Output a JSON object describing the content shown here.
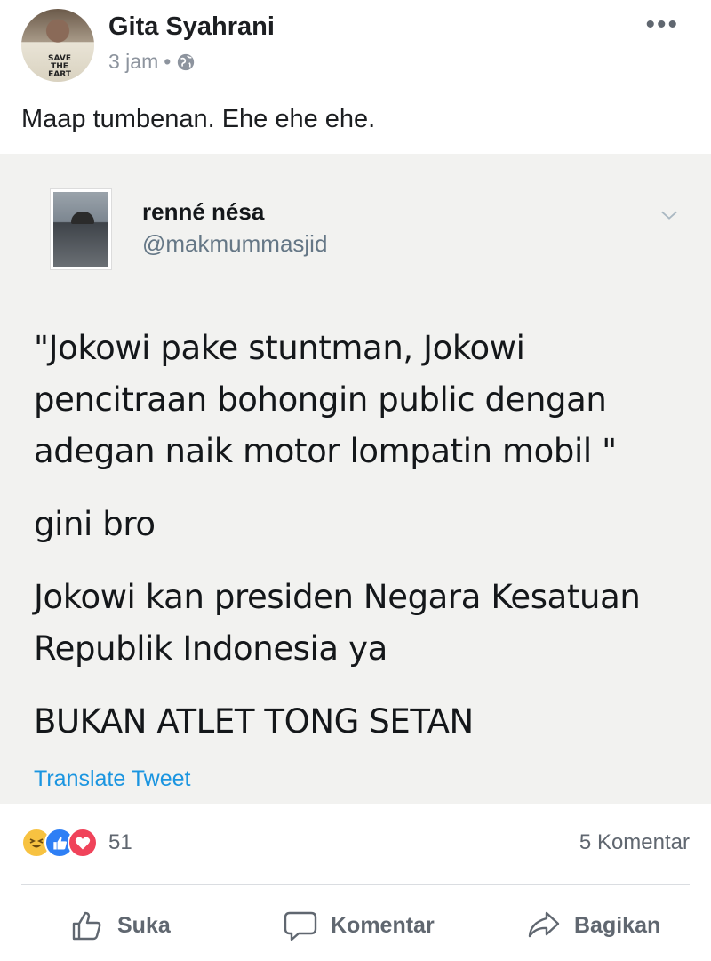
{
  "post": {
    "author": "Gita Syahrani",
    "time": "3 jam",
    "separator": "•",
    "avatar_text": "SAVE THE EART",
    "text": "Maap tumbenan. Ehe ehe ehe."
  },
  "tweet": {
    "name": "renné nésa",
    "handle": "@makmummasjid",
    "paragraphs": [
      "\"Jokowi pake stuntman, Jokowi pencitraan bohongin public dengan adegan naik motor lompatin mobil \"",
      "gini bro",
      "Jokowi kan presiden Negara Kesatuan Republik Indonesia ya",
      "BUKAN ATLET TONG SETAN"
    ],
    "translate_label": "Translate Tweet"
  },
  "stats": {
    "reaction_count": "51",
    "comments": "5 Komentar"
  },
  "actions": {
    "like": "Suka",
    "comment": "Komentar",
    "share": "Bagikan"
  },
  "colors": {
    "link": "#1b95e0",
    "muted": "#8d949e",
    "tweet_bg": "#f2f2f0"
  },
  "icons": [
    "globe-icon",
    "more-icon",
    "chevron-down-icon",
    "haha-icon",
    "like-reaction-icon",
    "love-icon",
    "thumbs-up-icon",
    "comment-icon",
    "share-icon"
  ]
}
